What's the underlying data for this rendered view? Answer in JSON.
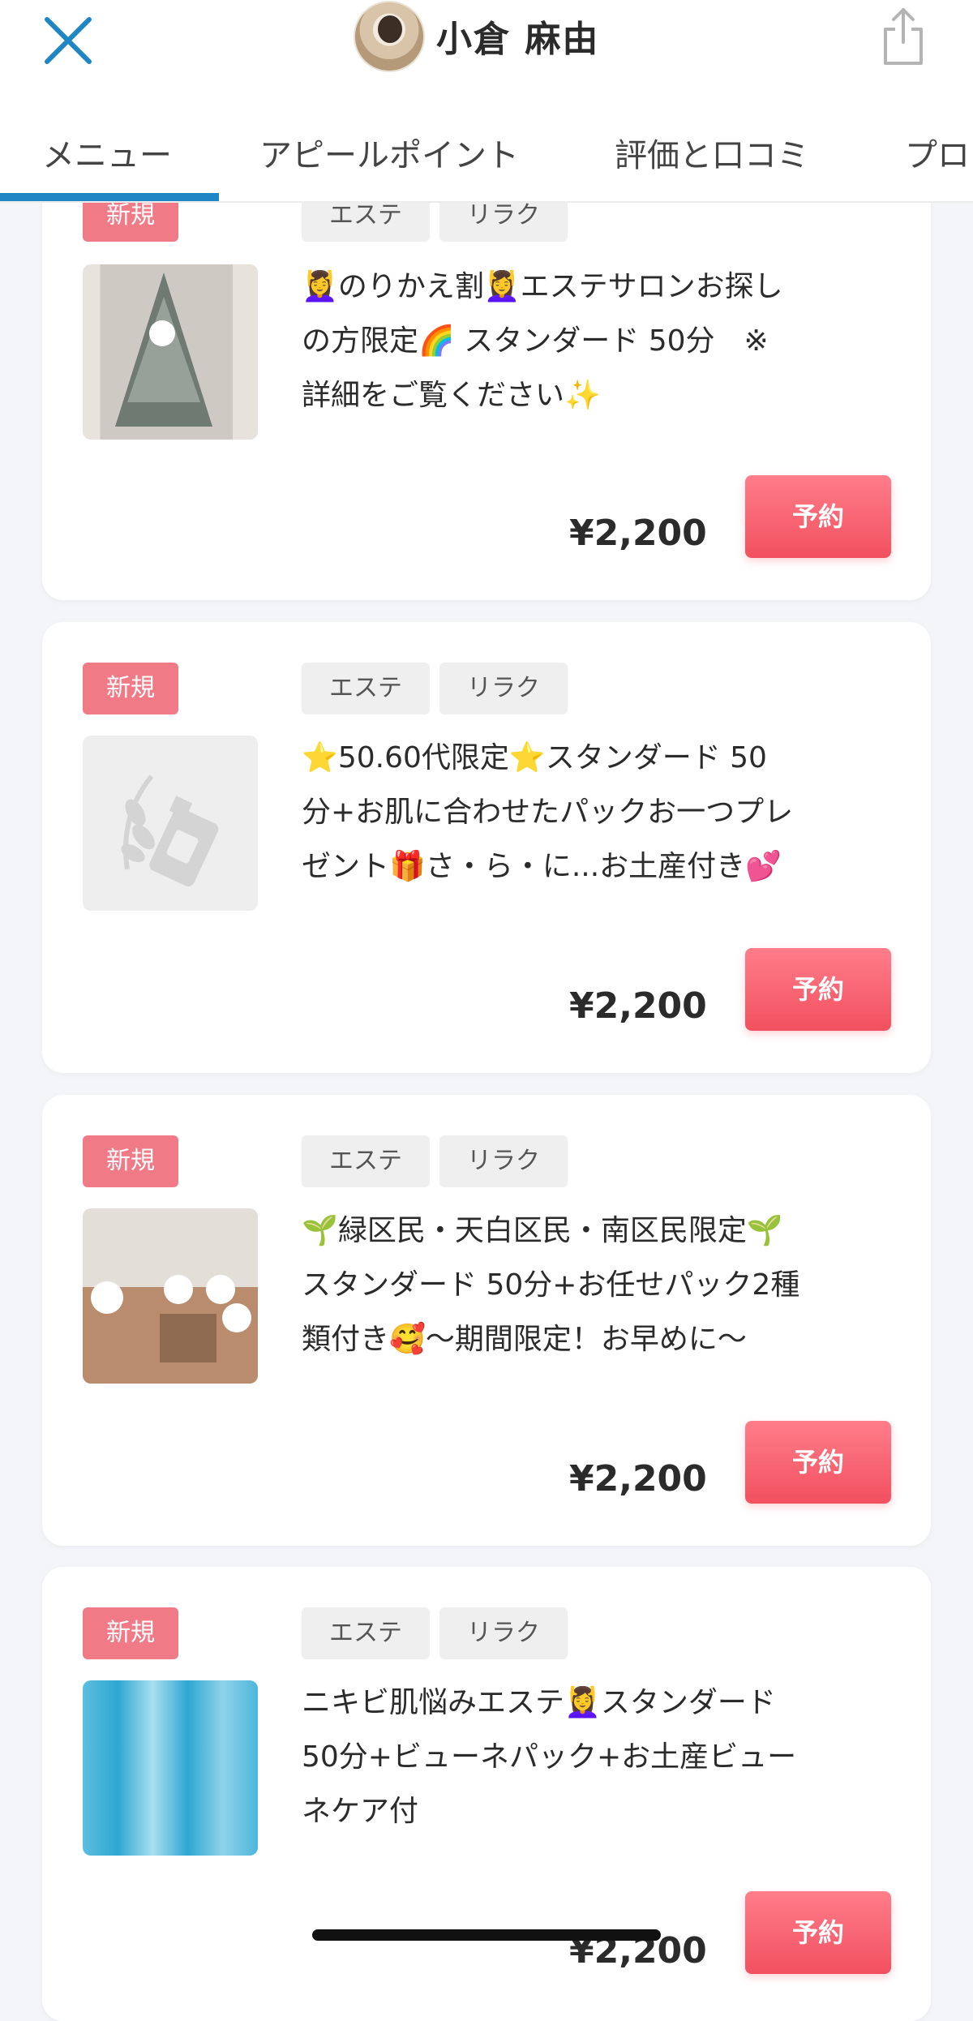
{
  "header": {
    "stylist_name": "小倉 麻由"
  },
  "tabs": [
    {
      "label": "メニュー",
      "active": true
    },
    {
      "label": "アピールポイント"
    },
    {
      "label": "評価と口コミ"
    },
    {
      "label": "プロ"
    }
  ],
  "menu_items": [
    {
      "badge": "新規",
      "tags": [
        "エステ",
        "リラク"
      ],
      "title_lines": [
        "💆‍♀️のりかえ割💆‍♀️エステサロンお探し",
        "の方限定🌈 スタンダード 50分　※",
        "詳細をご覧ください✨"
      ],
      "price": "¥2,200",
      "reserve_label": "予約"
    },
    {
      "badge": "新規",
      "tags": [
        "エステ",
        "リラク"
      ],
      "title_lines": [
        "⭐50.60代限定⭐スタンダード 50",
        "分+お肌に合わせたパックお一つプレ",
        "ゼント🎁さ・ら・に...お土産付き💕"
      ],
      "price": "¥2,200",
      "reserve_label": "予約"
    },
    {
      "badge": "新規",
      "tags": [
        "エステ",
        "リラク"
      ],
      "title_lines": [
        "🌱緑区民・天白区民・南区民限定🌱",
        "スタンダード 50分+お任せパック2種",
        "類付き🥰〜期間限定！お早めに〜"
      ],
      "price": "¥2,200",
      "reserve_label": "予約"
    },
    {
      "badge": "新規",
      "tags": [
        "エステ",
        "リラク"
      ],
      "title_lines": [
        "ニキビ肌悩みエステ💆‍♀️スタンダード",
        "50分+ビューネパック+お土産ビュー",
        "ネケア付"
      ],
      "price": "¥2,200",
      "reserve_label": "予約"
    }
  ]
}
